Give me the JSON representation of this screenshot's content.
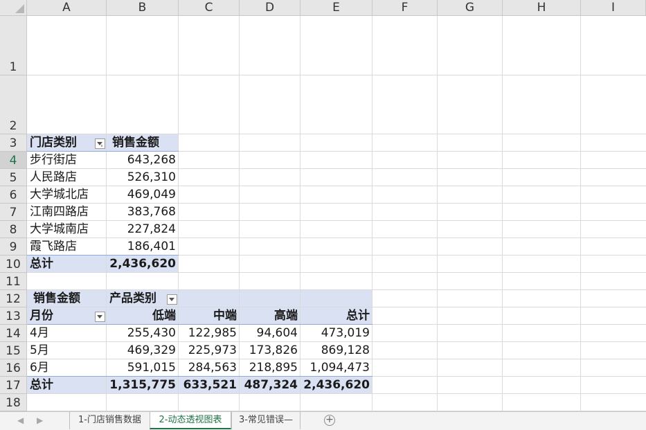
{
  "columns": [
    "A",
    "B",
    "C",
    "D",
    "E",
    "F",
    "G",
    "H",
    "I"
  ],
  "rows": [
    "1",
    "2",
    "3",
    "4",
    "5",
    "6",
    "7",
    "8",
    "9",
    "10",
    "11",
    "12",
    "13",
    "14",
    "15",
    "16",
    "17",
    "18"
  ],
  "selected_row": "4",
  "pivot1": {
    "header": {
      "category": "门店类别",
      "amount": "销售金额"
    },
    "rows": [
      {
        "store": "步行街店",
        "amount": "643,268"
      },
      {
        "store": "人民路店",
        "amount": "526,310"
      },
      {
        "store": "大学城北店",
        "amount": "469,049"
      },
      {
        "store": "江南四路店",
        "amount": "383,768"
      },
      {
        "store": "大学城南店",
        "amount": "227,824"
      },
      {
        "store": "霞飞路店",
        "amount": "186,401"
      }
    ],
    "total": {
      "label": "总计",
      "amount": "2,436,620"
    }
  },
  "pivot2": {
    "value_field": "销售金额",
    "column_field": "产品类别",
    "row_field": "月份",
    "col_headers": [
      "低端",
      "中端",
      "高端",
      "总计"
    ],
    "rows": [
      {
        "month": "4月",
        "vals": [
          "255,430",
          "122,985",
          "94,604",
          "473,019"
        ]
      },
      {
        "month": "5月",
        "vals": [
          "469,329",
          "225,973",
          "173,826",
          "869,128"
        ]
      },
      {
        "month": "6月",
        "vals": [
          "591,015",
          "284,563",
          "218,895",
          "1,094,473"
        ]
      }
    ],
    "total": {
      "label": "总计",
      "vals": [
        "1,315,775",
        "633,521",
        "487,324",
        "2,436,620"
      ]
    }
  },
  "tabs": [
    {
      "label": "1-门店销售数据",
      "active": false
    },
    {
      "label": "2-动态透视图表",
      "active": true
    },
    {
      "label": "3-常见错误—",
      "active": false
    }
  ],
  "colors": {
    "accent": "#217346",
    "pivot_band": "#d9e1f2",
    "pivot_line": "#8ea9db"
  },
  "icons": [
    "select-all-corner",
    "filter-dropdown-icon",
    "scroll-left-icon",
    "scroll-right-icon",
    "add-sheet-icon"
  ]
}
